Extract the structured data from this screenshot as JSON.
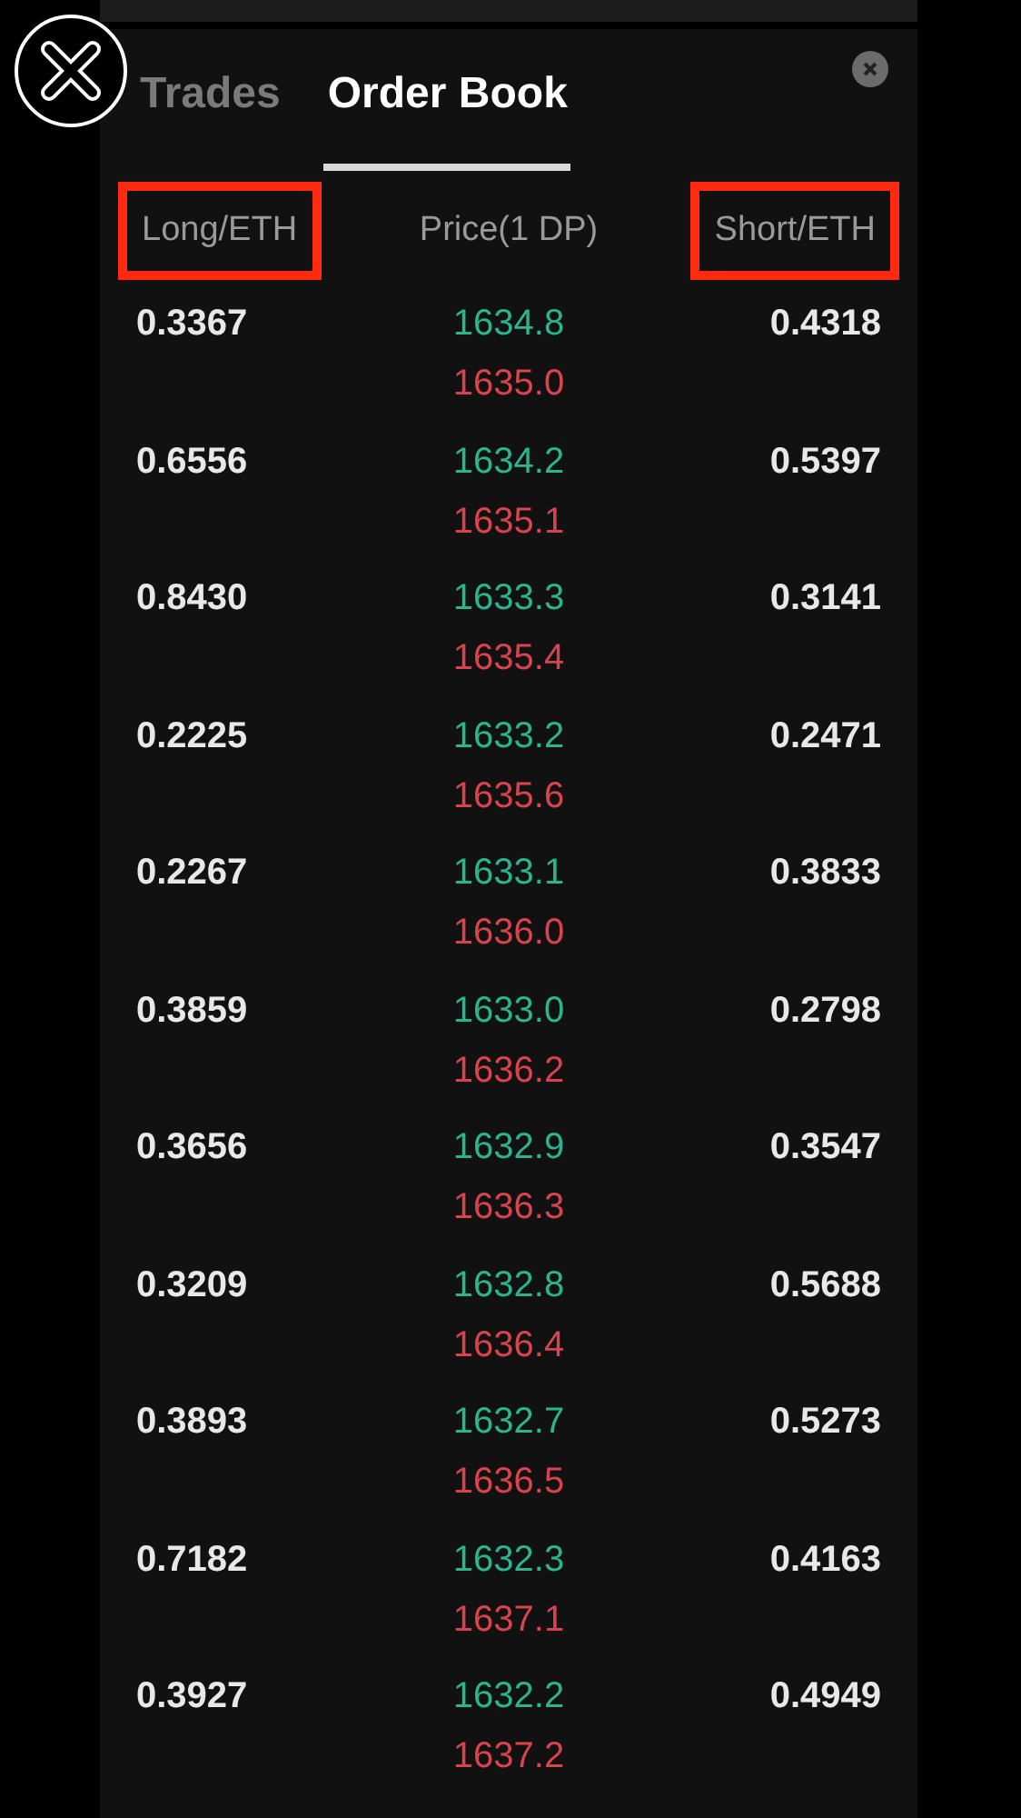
{
  "tabs": [
    {
      "label": "Trades",
      "selected": false
    },
    {
      "label": "Order Book",
      "selected": true
    }
  ],
  "columns": [
    {
      "label": "Long/ETH",
      "highlighted": true
    },
    {
      "label": "Price(1 DP)",
      "highlighted": false
    },
    {
      "label": "Short/ETH",
      "highlighted": true
    }
  ],
  "rows": [
    {
      "long": "0.3367",
      "bid": "1634.8",
      "ask": "1635.0",
      "short": "0.4318"
    },
    {
      "long": "0.6556",
      "bid": "1634.2",
      "ask": "1635.1",
      "short": "0.5397"
    },
    {
      "long": "0.8430",
      "bid": "1633.3",
      "ask": "1635.4",
      "short": "0.3141"
    },
    {
      "long": "0.2225",
      "bid": "1633.2",
      "ask": "1635.6",
      "short": "0.2471"
    },
    {
      "long": "0.2267",
      "bid": "1633.1",
      "ask": "1636.0",
      "short": "0.3833"
    },
    {
      "long": "0.3859",
      "bid": "1633.0",
      "ask": "1636.2",
      "short": "0.2798"
    },
    {
      "long": "0.3656",
      "bid": "1632.9",
      "ask": "1636.3",
      "short": "0.3547"
    },
    {
      "long": "0.3209",
      "bid": "1632.8",
      "ask": "1636.4",
      "short": "0.5688"
    },
    {
      "long": "0.3893",
      "bid": "1632.7",
      "ask": "1636.5",
      "short": "0.5273"
    },
    {
      "long": "0.7182",
      "bid": "1632.3",
      "ask": "1637.1",
      "short": "0.4163"
    },
    {
      "long": "0.3927",
      "bid": "1632.2",
      "ask": "1637.2",
      "short": "0.4949"
    }
  ]
}
